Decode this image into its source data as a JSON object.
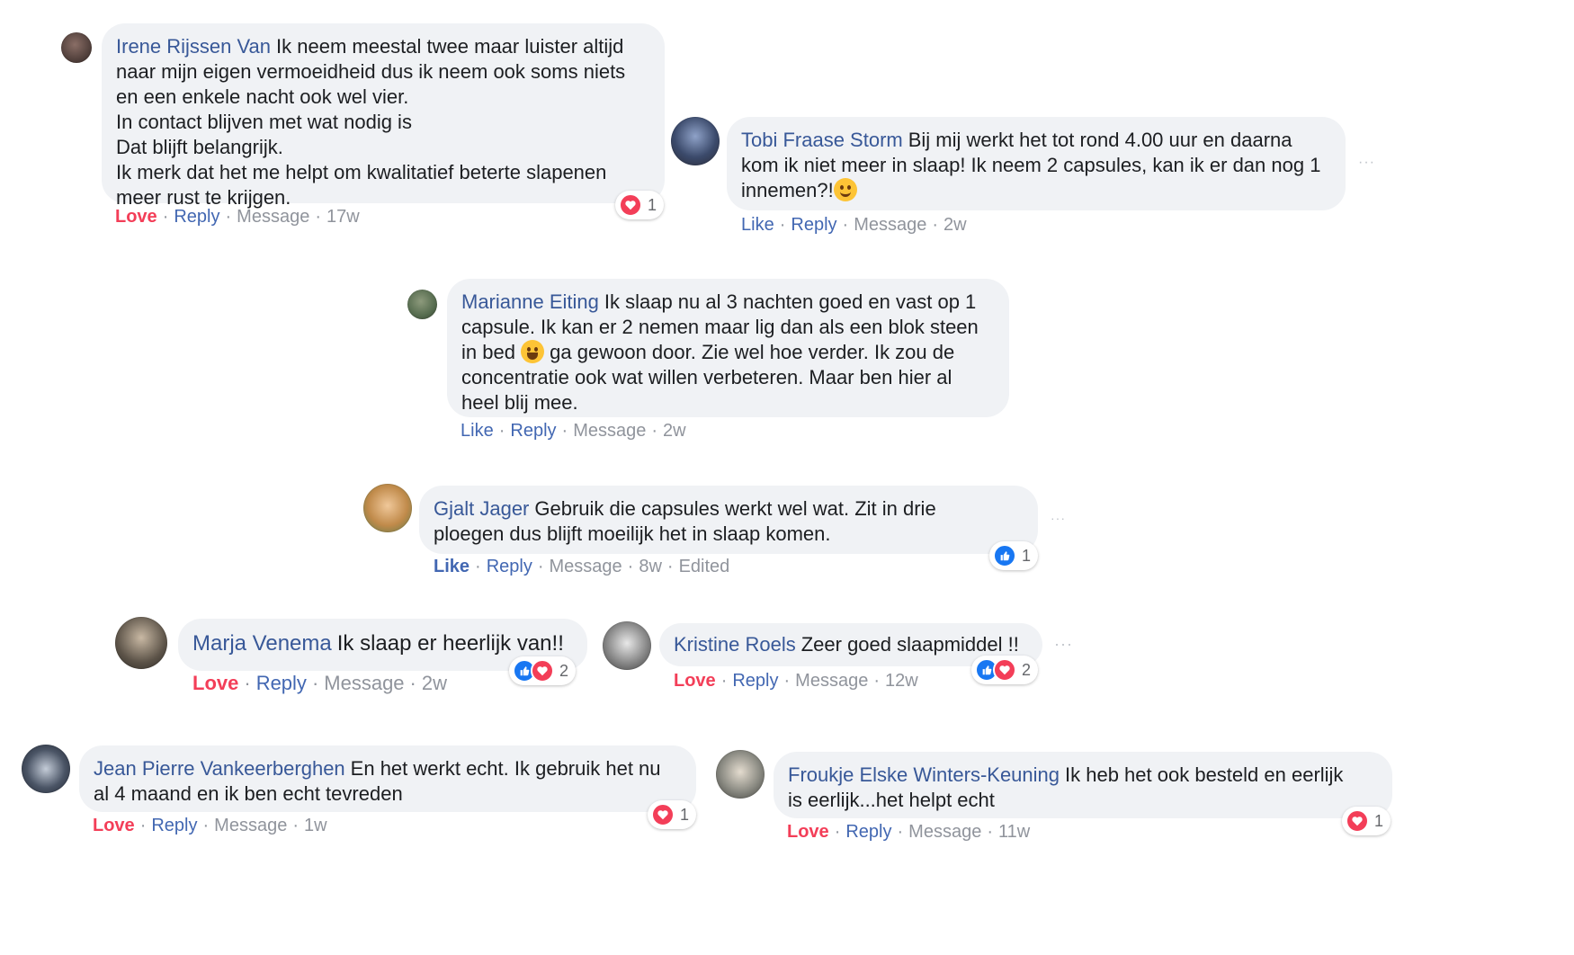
{
  "comments": [
    {
      "author": "Irene Rijssen Van",
      "text": "Ik neem meestal twee maar luister altijd\nnaar mijn eigen vermoeidheid dus ik neem ook soms niets\nen een enkele nacht ook wel vier.\nIn contact blijven met wat nodig is\nDat blijft belangrijk.\nIk merk dat het me helpt om kwalitatief beterte slapenen\nmeer rust te krijgen.",
      "action": "Love",
      "reply": "Reply",
      "message": "Message",
      "time": "17w",
      "reaction_count": "1",
      "avatar_color": "#4a3a36"
    },
    {
      "author": "Tobi Fraase Storm",
      "text": "Bij mij werkt het tot rond 4.00 uur en daarna\nkom ik niet meer in slaap! Ik neem 2 capsules, kan ik er dan nog 1\ninnemen?!",
      "emoji": "smirk-emoji",
      "action": "Like",
      "reply": "Reply",
      "message": "Message",
      "time": "2w",
      "avatar_color": "#3b4a6b"
    },
    {
      "author": "Marianne Eiting",
      "text_before_emoji": "Ik slaap nu al 3 nachten goed en vast op 1\ncapsule. Ik kan er 2 nemen maar lig dan als een blok steen\nin bed ",
      "text_after_emoji": " ga gewoon door. Zie wel hoe verder. Ik zou de\nconcentratie ook wat willen verbeteren. Maar ben hier al\nheel blij mee.",
      "emoji": "laughing-emoji",
      "action": "Like",
      "reply": "Reply",
      "message": "Message",
      "time": "2w",
      "avatar_color": "#556b4e"
    },
    {
      "author": "Gjalt Jager",
      "text": "Gebruik die capsules werkt wel wat. Zit in drie\nploegen dus blijft moeilijk het in slaap komen.",
      "action": "Like",
      "reply": "Reply",
      "message": "Message",
      "time": "8w",
      "edited": "Edited",
      "reaction_count": "1",
      "avatar_color": "#c08a4a"
    },
    {
      "author": "Marja Venema",
      "text": "Ik slaap er heerlijk van!!",
      "action": "Love",
      "reply": "Reply",
      "message": "Message",
      "time": "2w",
      "reaction_count": "2",
      "avatar_color": "#5c5348"
    },
    {
      "author": "Kristine Roels",
      "text": "Zeer goed slaapmiddel !!",
      "action": "Love",
      "reply": "Reply",
      "message": "Message",
      "time": "12w",
      "reaction_count": "2",
      "avatar_color": "#6e6e6e"
    },
    {
      "author": "Jean Pierre Vankeerberghen",
      "text": "En het werkt echt. Ik gebruik het nu\nal 4 maand en ik ben echt tevreden",
      "action": "Love",
      "reply": "Reply",
      "message": "Message",
      "time": "1w",
      "reaction_count": "1",
      "avatar_color": "#4b5566"
    },
    {
      "author": "Froukje Elske Winters-Keuning",
      "text": "Ik heb het ook besteld en eerlijk\nis eerlijk...het helpt echt",
      "action": "Love",
      "reply": "Reply",
      "message": "Message",
      "time": "11w",
      "reaction_count": "1",
      "avatar_color": "#8a8a82"
    }
  ],
  "separator": "·",
  "more_glyph": "···",
  "colors": {
    "bubble": "#f0f2f5",
    "author": "#385898",
    "love": "#f33e58",
    "like": "#4267b2",
    "meta": "#90949c"
  }
}
